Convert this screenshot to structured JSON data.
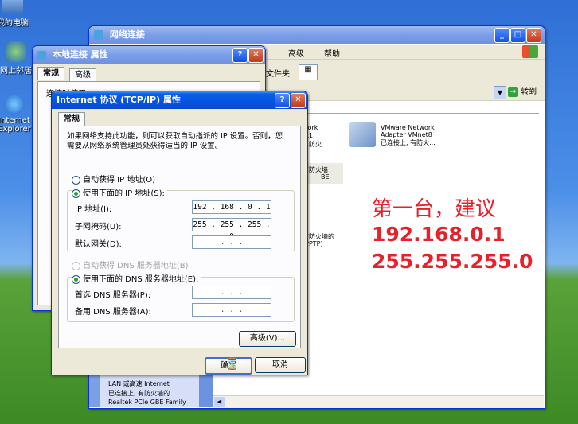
{
  "desktop": {
    "icons": [
      {
        "label": "我的电脑"
      },
      {
        "label": "网上邻居"
      },
      {
        "label": "Internet Explorer"
      }
    ]
  },
  "net_window": {
    "title": "网络连接",
    "menu_help": "帮助",
    "menu_advanced": "高级",
    "toolbar_folder": "文件夹",
    "go_label": "转到",
    "adapters": [
      {
        "line1": "work",
        "line2": "et1"
      },
      {
        "line1": "VMware Network",
        "line2": "Adapter VMnet8",
        "line3": "已连接上, 有防火..."
      }
    ],
    "partial_texts": [
      "有防火",
      "有防火墙",
      "PPTP)",
      "有防火墙的",
      "(PPTP)",
      "BE"
    ],
    "bottom_item": {
      "line1": "LAN 或高速 Internet",
      "line2": "已连接上, 有防火墙的",
      "line3": "Realtek PCIe GBE Family"
    }
  },
  "local_conn_window": {
    "title": "本地连接 属性",
    "tab_general": "常规",
    "tab_advanced": "高级",
    "connect_using": "连接时使用"
  },
  "tcpip_dialog": {
    "title": "Internet 协议 (TCP/IP) 属性",
    "tab": "常规",
    "description": "如果网络支持此功能，则可以获取自动指派的 IP 设置。否则，您需要从网络系统管理员处获得适当的 IP 设置。",
    "auto_ip": "自动获得 IP 地址(O)",
    "use_ip": "使用下面的 IP 地址(S):",
    "ip_label": "IP 地址(I):",
    "mask_label": "子网掩码(U):",
    "gateway_label": "默认网关(D):",
    "ip_value": "192 . 168 . 0  . 1",
    "mask_value": "255 . 255 . 255 . 0",
    "gateway_value": ".      .      .",
    "auto_dns": "自动获得 DNS 服务器地址(B)",
    "use_dns": "使用下面的 DNS 服务器地址(E):",
    "pref_dns_label": "首选 DNS 服务器(P):",
    "alt_dns_label": "备用 DNS 服务器(A):",
    "pref_dns_value": ".      .      .",
    "alt_dns_value": ".      .      .",
    "advanced_button": "高级(V)...",
    "ok_button": "确定",
    "cancel_button": "取消"
  },
  "overlay": {
    "line1": "第一台，建议",
    "line2": "192.168.0.1",
    "line3": "255.255.255.0"
  },
  "colors": {
    "overlay": "#e8202a",
    "title_active": "#0554e0",
    "dialog_bg": "#ece9d8"
  }
}
